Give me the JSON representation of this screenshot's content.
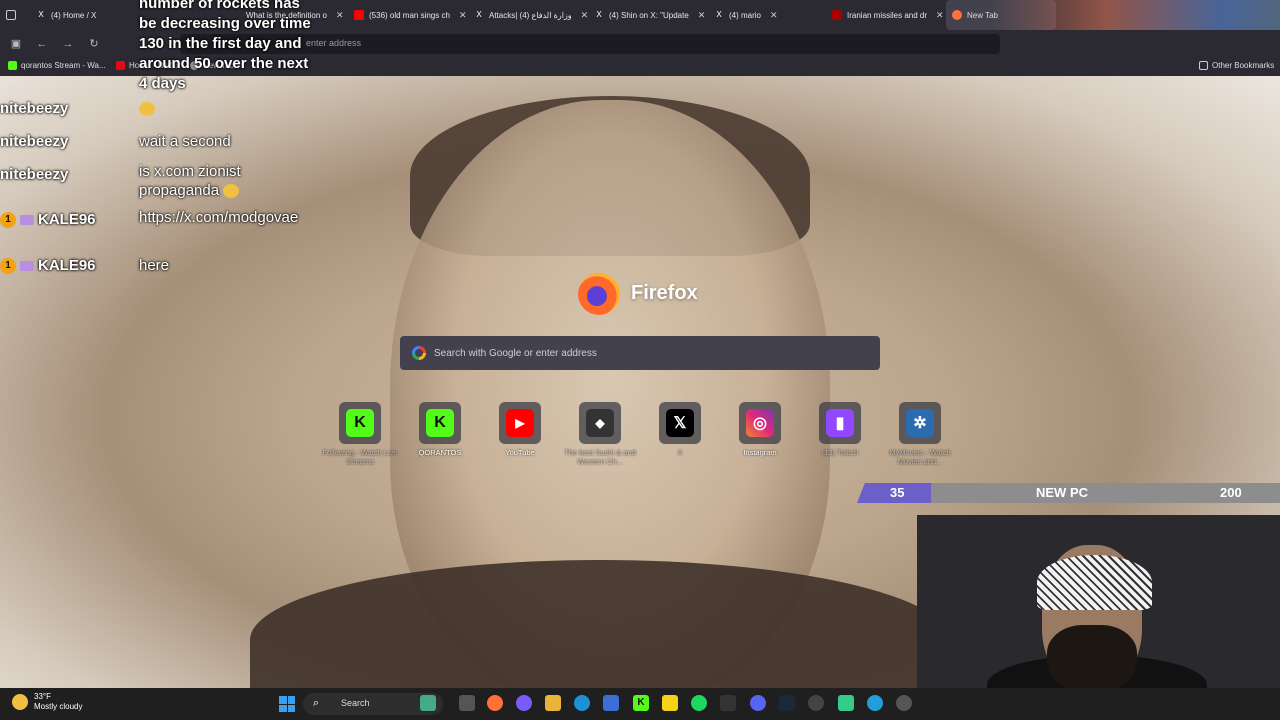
{
  "browser": {
    "tabs": [
      {
        "label": "(4) Home / X",
        "icon": "x-icon"
      },
      {
        "label": "What is the definition o",
        "icon": "page-icon"
      },
      {
        "label": "(536) old man sings ch",
        "icon": "youtube-icon"
      },
      {
        "label": "Attacks| وزارة الدفاع (4)",
        "icon": "x-icon"
      },
      {
        "label": "(4) Shin on X: \"Update",
        "icon": "x-icon"
      },
      {
        "label": "(4) mario",
        "icon": "x-icon"
      },
      {
        "label": "Iranian missiles and dr",
        "icon": "page-icon"
      },
      {
        "label": "New Tab",
        "icon": "firefox-icon"
      }
    ],
    "url_placeholder": "enter address",
    "bookmarks": [
      {
        "label": "qorantos Stream - Wa...",
        "color": "#53fc18"
      },
      {
        "label": "Home - Netflix",
        "color": "#e50914"
      },
      {
        "label": "New Tab",
        "color": "#999999"
      }
    ],
    "other_bookmarks": "Other Bookmarks"
  },
  "chat": {
    "top_message": "number of rockets has be decreasing over time 130 in the first day and around 50 over the next 4 days",
    "messages": [
      {
        "user": "nitebeezy",
        "text": ""
      },
      {
        "user": "nitebeezy",
        "text": "wait a second"
      },
      {
        "user": "nitebeezy",
        "text": "is x.com zionist propaganda"
      },
      {
        "user": "KALE96",
        "badge": "1",
        "text": "https://x.com/modgovae"
      },
      {
        "user": "KALE96",
        "badge": "1",
        "text": "here"
      }
    ]
  },
  "newtab": {
    "brand": "Firefox",
    "search_placeholder": "Search with Google or enter address",
    "shortcuts": [
      {
        "label": "Following - Watch Live Streams",
        "glyph": "K",
        "color": "#53fc18",
        "faded": true
      },
      {
        "label": "QORANTOS",
        "glyph": "K",
        "color": "#53fc18",
        "faded": false
      },
      {
        "label": "YouTube",
        "glyph": "▶",
        "color": "#ff0000",
        "faded": false
      },
      {
        "label": "The best Sushi & and Western Ch...",
        "glyph": "◆",
        "color": "#333333",
        "faded": true
      },
      {
        "label": "X",
        "glyph": "𝕏",
        "color": "#000000",
        "faded": true
      },
      {
        "label": "Instagram",
        "glyph": "◎",
        "color": "#d6249f",
        "faded": false
      },
      {
        "label": "(13) Twitch",
        "glyph": "▮",
        "color": "#9146ff",
        "faded": true
      },
      {
        "label": "MyMovies - Watch Movies and...",
        "glyph": "✲",
        "color": "#2b6cb0",
        "faded": true
      }
    ]
  },
  "goal": {
    "current": "35",
    "label": "NEW PC",
    "target": "200",
    "fill_color": "#6b5fc9"
  },
  "taskbar": {
    "temperature": "33°F",
    "condition": "Mostly cloudy",
    "search_label": "Search"
  }
}
